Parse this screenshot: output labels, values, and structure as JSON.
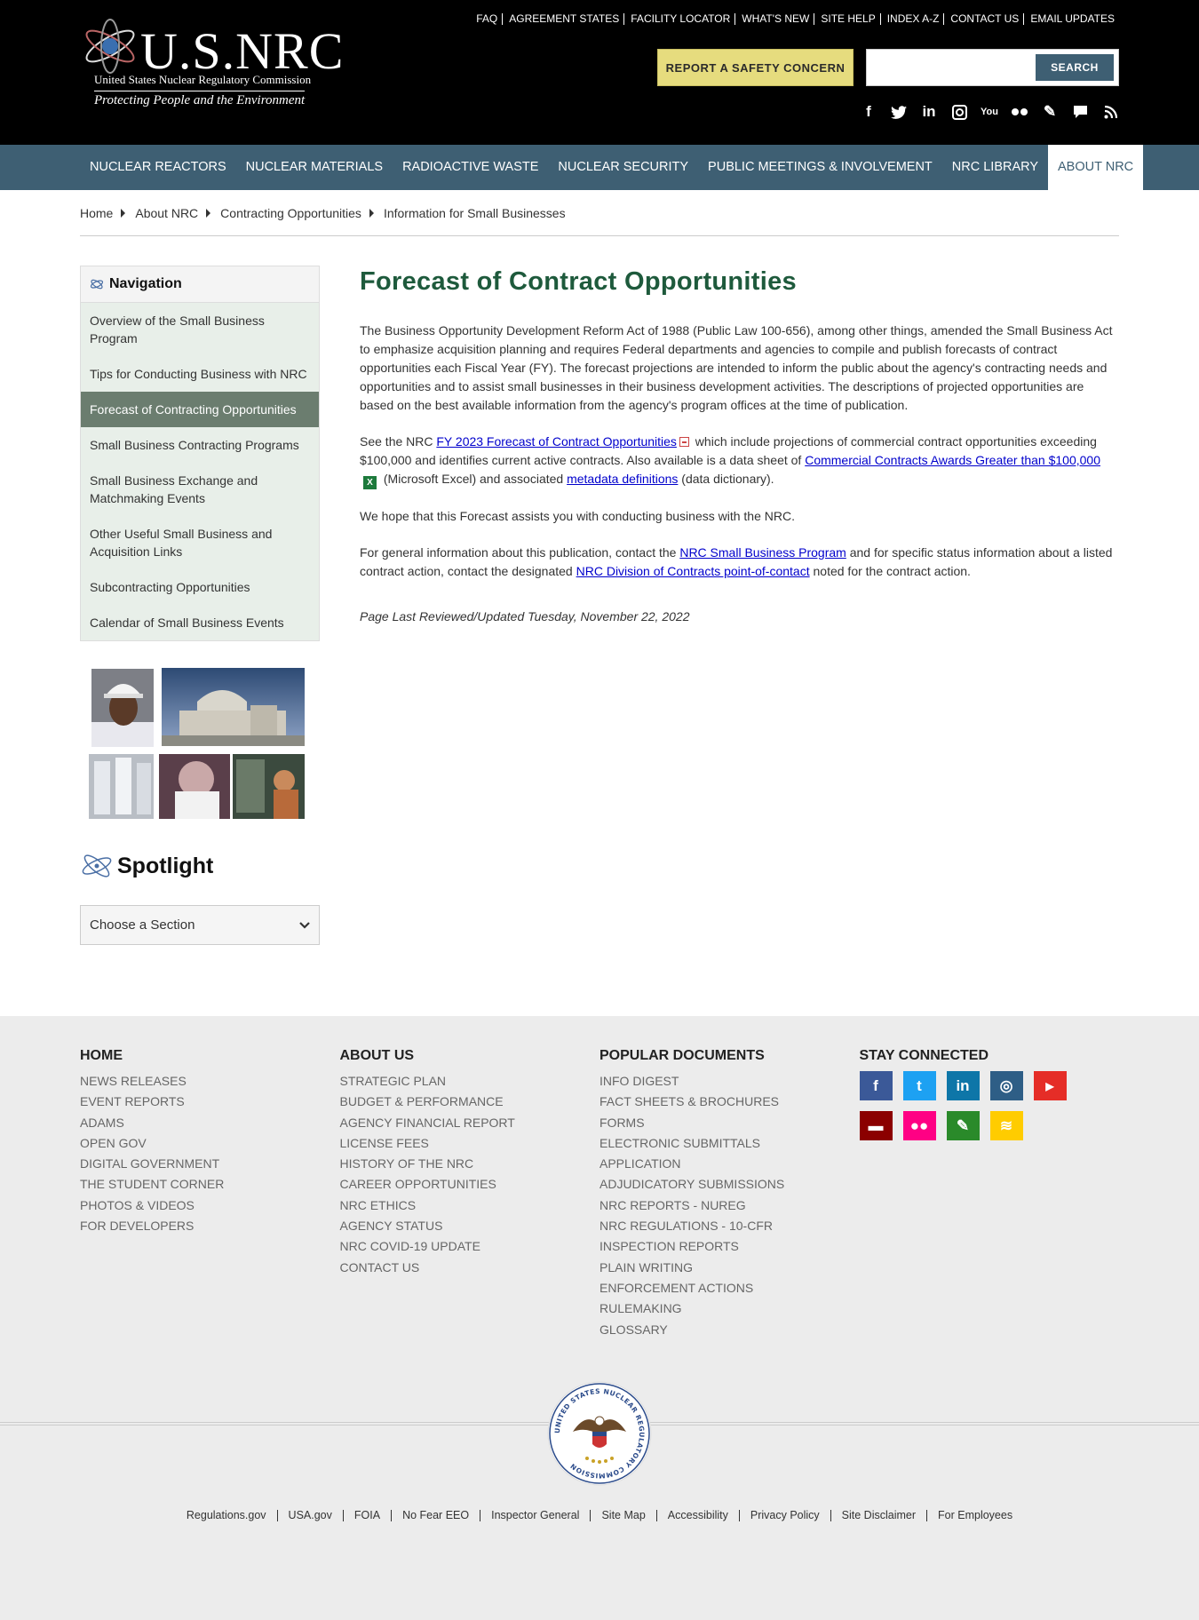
{
  "header": {
    "logo_title": "U.S.NRC",
    "logo_subtitle": "United States Nuclear Regulatory Commission",
    "logo_tagline": "Protecting People and the Environment",
    "top_links": [
      "FAQ",
      "AGREEMENT STATES",
      "FACILITY LOCATOR",
      "WHAT'S NEW",
      "SITE HELP",
      "INDEX A-Z",
      "CONTACT US",
      "EMAIL UPDATES"
    ],
    "report_button": "REPORT A SAFETY CONCERN",
    "search_placeholder": "",
    "search_button": "SEARCH",
    "social_icons": [
      "facebook-icon",
      "twitter-icon",
      "linkedin-icon",
      "instagram-icon",
      "youtube-icon",
      "flickr-icon",
      "pencil-icon",
      "comment-icon",
      "rss-icon"
    ]
  },
  "mainnav": {
    "items": [
      "NUCLEAR REACTORS",
      "NUCLEAR MATERIALS",
      "RADIOACTIVE WASTE",
      "NUCLEAR SECURITY",
      "PUBLIC MEETINGS & INVOLVEMENT",
      "NRC LIBRARY",
      "ABOUT NRC"
    ],
    "active": "ABOUT NRC"
  },
  "breadcrumb": [
    "Home",
    "About NRC",
    "Contracting Opportunities",
    "Information for Small Businesses"
  ],
  "sidebar": {
    "nav_title": "Navigation",
    "items": [
      "Overview of the Small Business Program",
      "Tips for Conducting Business with NRC",
      "Forecast of Contracting Opportunities",
      "Small Business Contracting Programs",
      "Small Business Exchange and Matchmaking Events",
      "Other Useful Small Business and Acquisition Links",
      "Subcontracting Opportunities",
      "Calendar of Small Business Events"
    ],
    "active_item": "Forecast of Contracting Opportunities",
    "spotlight_title": "Spotlight",
    "choose_label": "Choose a Section"
  },
  "main": {
    "title": "Forecast of Contract Opportunities",
    "p1": "The Business Opportunity Development Reform Act of 1988 (Public Law 100-656), among other things, amended the Small Business Act to emphasize acquisition planning and requires Federal departments and agencies to compile and publish forecasts of contract opportunities each Fiscal Year (FY). The forecast projections are intended to inform the public about the agency's contracting needs and opportunities and to assist small businesses in their business development activities. The descriptions of projected opportunities are based on the best available information from the agency's program offices at the time of publication.",
    "p2_a": "See the NRC ",
    "p2_link1": "FY 2023 Forecast of Contract Opportunities",
    "p2_b": " which include projections of commercial contract opportunities exceeding $100,000 and identifies current active contracts. Also available is a data sheet of ",
    "p2_link2": "Commercial Contracts Awards Greater than $100,000",
    "p2_c": " (Microsoft Excel) and associated ",
    "p2_link3": "metadata definitions",
    "p2_d": " (data dictionary).",
    "p3": "We hope that this Forecast assists you with conducting business with the NRC.",
    "p4_a": "For general information about this publication, contact the ",
    "p4_link1": "NRC Small Business Program",
    "p4_b": " and for specific status information about a listed contract action, contact the designated ",
    "p4_link2": "NRC Division of Contracts point-of-contact",
    "p4_c": " noted for the contract action.",
    "reviewed": "Page Last Reviewed/Updated Tuesday, November 22, 2022"
  },
  "footer": {
    "columns": [
      {
        "title": "HOME",
        "links": [
          "NEWS RELEASES",
          "EVENT REPORTS",
          "ADAMS",
          "OPEN GOV",
          "DIGITAL GOVERNMENT",
          "THE STUDENT CORNER",
          "PHOTOS & VIDEOS",
          "FOR DEVELOPERS"
        ]
      },
      {
        "title": "ABOUT US",
        "links": [
          "STRATEGIC PLAN",
          "BUDGET & PERFORMANCE",
          "AGENCY FINANCIAL REPORT",
          "LICENSE FEES",
          "HISTORY OF THE NRC",
          "CAREER OPPORTUNITIES",
          "NRC ETHICS",
          "AGENCY STATUS",
          "NRC COVID-19 UPDATE",
          "CONTACT US"
        ]
      },
      {
        "title": "POPULAR DOCUMENTS",
        "links": [
          "INFO DIGEST",
          "FACT SHEETS & BROCHURES",
          "FORMS",
          "ELECTRONIC SUBMITTALS",
          "APPLICATION",
          "ADJUDICATORY SUBMISSIONS",
          "NRC REPORTS - NUREG",
          "NRC REGULATIONS - 10-CFR",
          "INSPECTION REPORTS",
          "PLAIN WRITING",
          "ENFORCEMENT ACTIONS",
          "RULEMAKING",
          "GLOSSARY"
        ]
      },
      {
        "title": "STAY CONNECTED",
        "links": []
      }
    ],
    "social": [
      {
        "name": "facebook-icon",
        "color": "#3b5998",
        "glyph": "f"
      },
      {
        "name": "twitter-icon",
        "color": "#1da1f2",
        "glyph": "t"
      },
      {
        "name": "linkedin-icon",
        "color": "#0e76a8",
        "glyph": "in"
      },
      {
        "name": "instagram-icon",
        "color": "#2e5e86",
        "glyph": "◎"
      },
      {
        "name": "youtube-icon",
        "color": "#e52d27",
        "glyph": "▶"
      },
      {
        "name": "comment-icon",
        "color": "#8b0000",
        "glyph": "▬"
      },
      {
        "name": "flickr-icon",
        "color": "#ff0084",
        "glyph": "●●"
      },
      {
        "name": "pencil-icon",
        "color": "#2a8a2a",
        "glyph": "✎"
      },
      {
        "name": "rss-icon",
        "color": "#ffcc00",
        "glyph": "≋"
      }
    ],
    "seal_text": "UNITED STATES NUCLEAR REGULATORY COMMISSION",
    "bottom_links": [
      "Regulations.gov",
      "USA.gov",
      "FOIA",
      "No Fear EEO",
      "Inspector General",
      "Site Map",
      "Accessibility",
      "Privacy Policy",
      "Site Disclaimer",
      "For Employees"
    ]
  }
}
